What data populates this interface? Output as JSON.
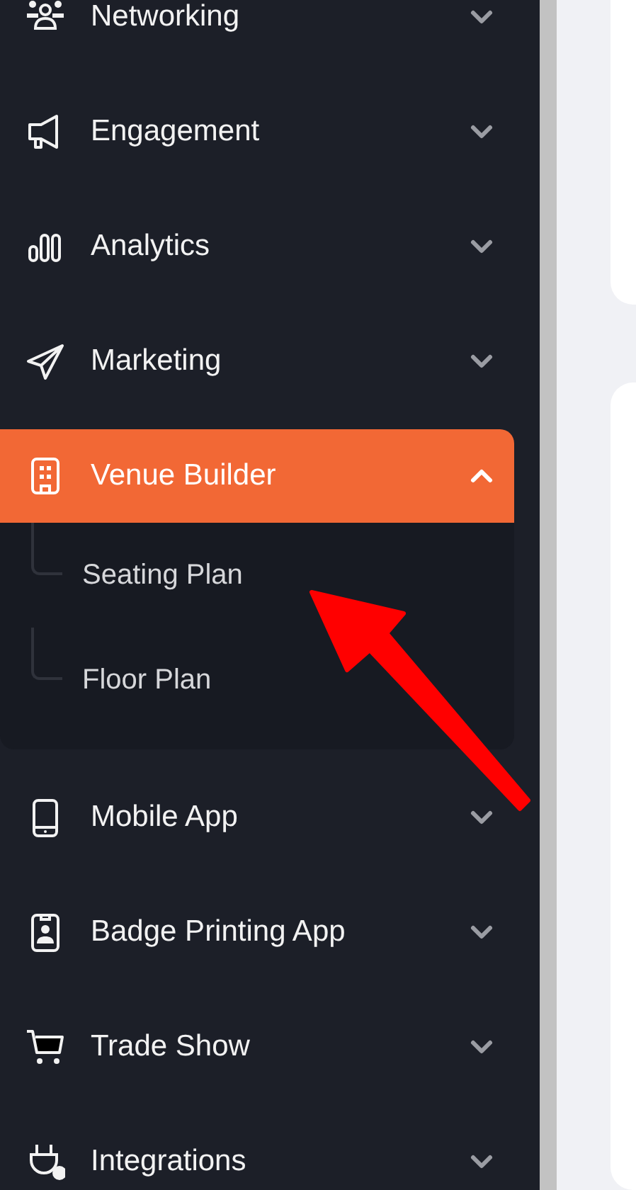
{
  "sidebar": {
    "items": [
      {
        "label": "Networking",
        "selected": false,
        "expanded": false
      },
      {
        "label": "Engagement",
        "selected": false,
        "expanded": false
      },
      {
        "label": "Analytics",
        "selected": false,
        "expanded": false
      },
      {
        "label": "Marketing",
        "selected": false,
        "expanded": false
      },
      {
        "label": "Venue Builder",
        "selected": true,
        "expanded": true,
        "children": [
          {
            "label": "Seating Plan"
          },
          {
            "label": "Floor Plan"
          }
        ]
      },
      {
        "label": "Mobile App",
        "selected": false,
        "expanded": false
      },
      {
        "label": "Badge Printing App",
        "selected": false,
        "expanded": false
      },
      {
        "label": "Trade Show",
        "selected": false,
        "expanded": false
      },
      {
        "label": "Integrations",
        "selected": false,
        "expanded": false
      }
    ]
  }
}
